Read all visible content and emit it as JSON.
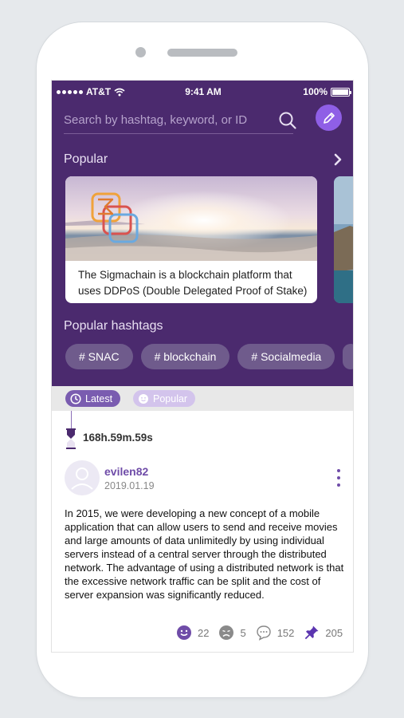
{
  "status_bar": {
    "carrier": "AT&T",
    "time": "9:41 AM",
    "battery": "100%"
  },
  "search": {
    "placeholder": "Search by hashtag, keyword, or ID"
  },
  "popular": {
    "title": "Popular",
    "cards": [
      {
        "caption": "The Sigmachain is a blockchain platform that uses DDPoS (Double Delegated Proof of Stake) .."
      }
    ]
  },
  "hashtags": {
    "title": "Popular hashtags",
    "items": [
      "# SNAC",
      "# blockchain",
      "# Socialmedia"
    ]
  },
  "filters": {
    "latest": "Latest",
    "popular": "Popular"
  },
  "post": {
    "timer": "168h.59m.59s",
    "username": "evilen82",
    "date": "2019.01.19",
    "body": "In 2015, we were developing a new concept of a mobile application that can allow users to send and receive movies and large amounts of data unlimitedly by using individual servers instead of a central server through the distributed network. The advantage of using a distributed network is that the excessive network traffic can be split and the cost of server expansion was significantly reduced.",
    "reactions": {
      "likes": "22",
      "dislikes": "5",
      "comments": "152",
      "pins": "205"
    }
  },
  "colors": {
    "header_bg": "#4b2a6e",
    "accent": "#8f5fe6",
    "username": "#6f4ca8"
  }
}
